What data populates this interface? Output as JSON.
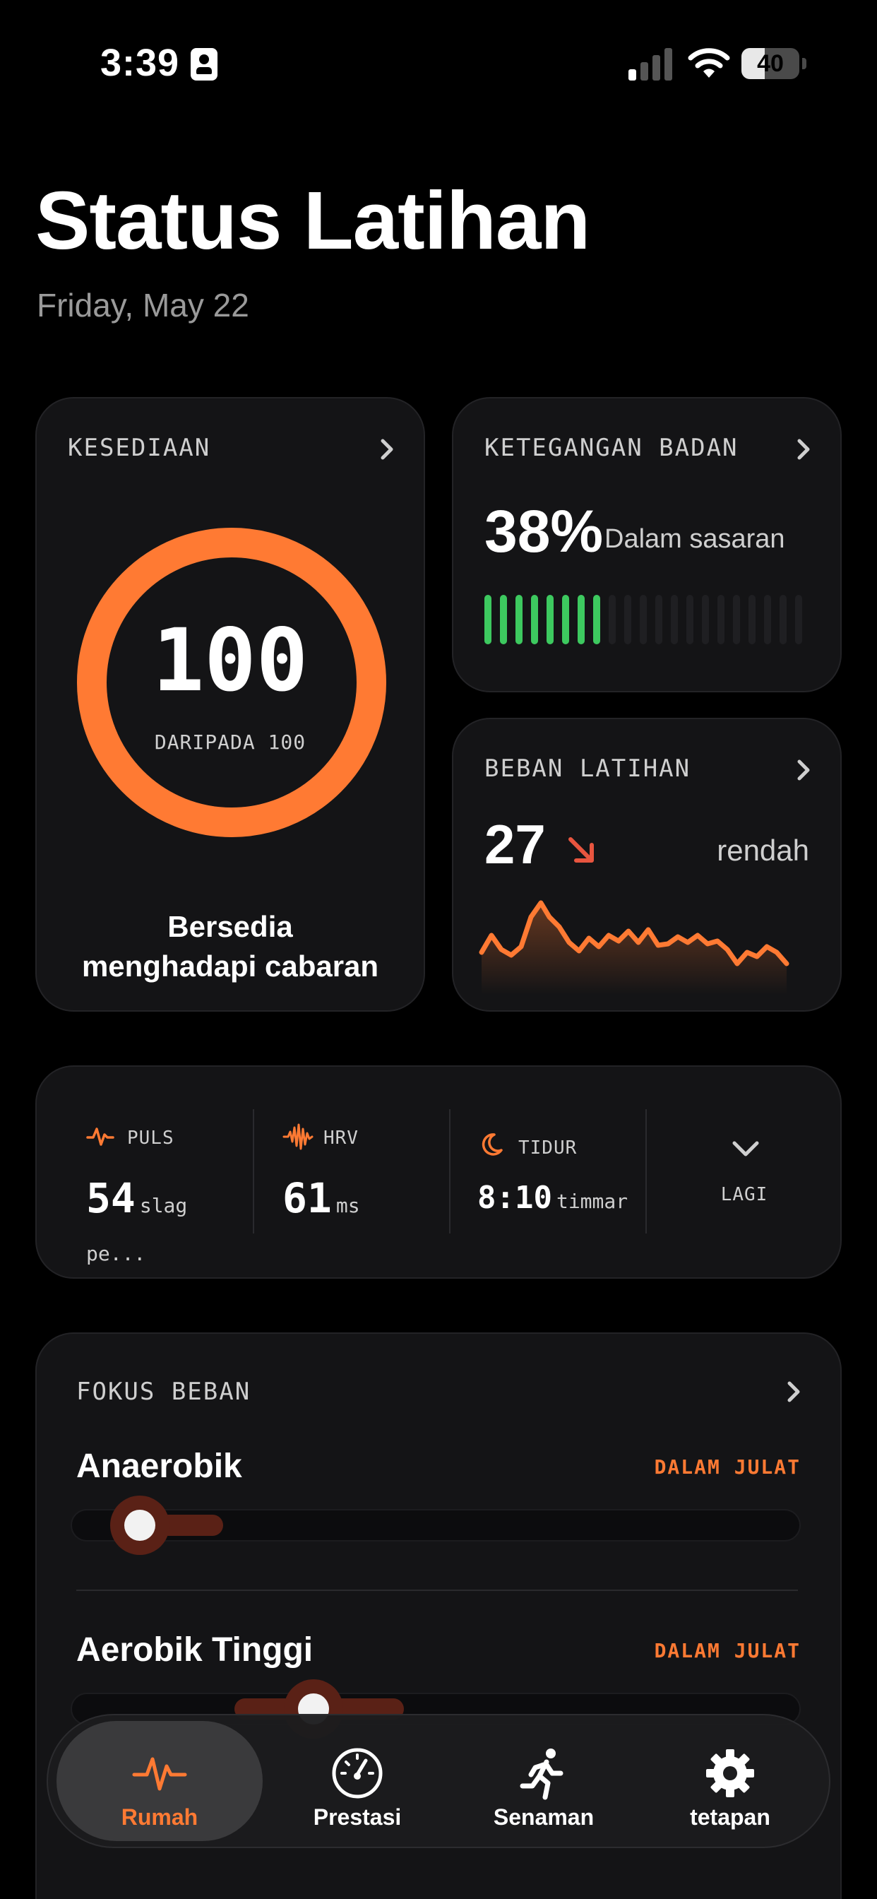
{
  "status_bar": {
    "time": "3:39",
    "battery": "40"
  },
  "page": {
    "title": "Status Latihan",
    "date": "Friday, May 22"
  },
  "readiness": {
    "label": "KESEDIAAN",
    "score": "100",
    "out_of": "DARIPADA 100",
    "message_line1": "Bersedia",
    "message_line2": "menghadapi cabaran",
    "fraction": 1.0
  },
  "strain": {
    "label": "KETEGANGAN BADAN",
    "percent": "38%",
    "status": "Dalam sasaran",
    "filled_bars": 8,
    "total_bars": 21
  },
  "training_load": {
    "label": "BEBAN LATIHAN",
    "value": "27",
    "trend": "down",
    "status": "rendah"
  },
  "metrics": {
    "pulse": {
      "label": "PULS",
      "value": "54",
      "unit": "slag pe..."
    },
    "hrv": {
      "label": "HRV",
      "value": "61",
      "unit": "ms"
    },
    "sleep": {
      "label": "TIDUR",
      "value": "8:10",
      "unit": "timmar"
    },
    "more": {
      "label": "LAGI"
    }
  },
  "focus": {
    "label": "FOKUS BEBAN",
    "items": [
      {
        "name": "Anaerobik",
        "status": "DALAM JULAT"
      },
      {
        "name": "Aerobik Tinggi",
        "status": "DALAM JULAT"
      }
    ]
  },
  "tabbar": {
    "tabs": [
      {
        "label": "Rumah",
        "icon": "heartbeat-icon",
        "active": true
      },
      {
        "label": "Prestasi",
        "icon": "gauge-icon",
        "active": false
      },
      {
        "label": "Senaman",
        "icon": "running-icon",
        "active": false
      },
      {
        "label": "tetapan",
        "icon": "gear-icon",
        "active": false
      }
    ]
  },
  "colors": {
    "accent": "#ff7a33",
    "green": "#3dc95f",
    "trend_down": "#e8553f",
    "card": "#141416",
    "background": "#000000"
  }
}
